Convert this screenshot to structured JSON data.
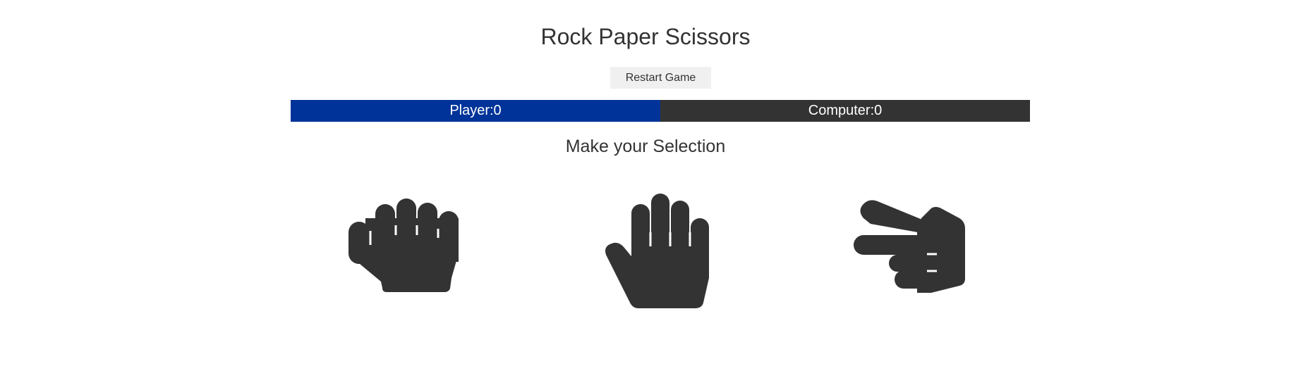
{
  "title": "Rock Paper Scissors",
  "restart_label": "Restart Game",
  "scoreboard": {
    "player": "Player:0",
    "computer": "Computer:0",
    "player_color": "#003399",
    "computer_color": "#333333"
  },
  "prompt": "Make your Selection",
  "choices": [
    {
      "icon": "rock-hand-icon"
    },
    {
      "icon": "paper-hand-icon"
    },
    {
      "icon": "scissors-hand-icon"
    }
  ]
}
